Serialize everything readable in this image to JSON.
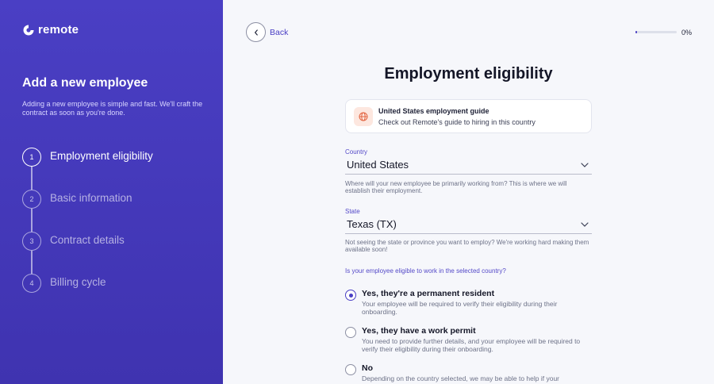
{
  "brand": {
    "name": "remote"
  },
  "sidebar": {
    "title": "Add a new employee",
    "description": "Adding a new employee is simple and fast. We'll craft the contract as soon as you're done.",
    "steps": [
      {
        "number": "1",
        "label": "Employment eligibility",
        "active": true
      },
      {
        "number": "2",
        "label": "Basic information",
        "active": false
      },
      {
        "number": "3",
        "label": "Contract details",
        "active": false
      },
      {
        "number": "4",
        "label": "Billing cycle",
        "active": false
      }
    ]
  },
  "header": {
    "back_label": "Back",
    "progress_text": "0%",
    "progress_fraction": 0.04
  },
  "main": {
    "title": "Employment eligibility",
    "guide": {
      "title": "United States employment guide",
      "subtitle": "Check out Remote's guide to hiring in this country"
    },
    "country": {
      "label": "Country",
      "value": "United States",
      "help": "Where will your new employee be primarily working from? This is where we will establish their employment."
    },
    "state": {
      "label": "State",
      "value": "Texas (TX)",
      "help": "Not seeing the state or province you want to employ? We're working hard making them available soon!"
    },
    "eligibility": {
      "question": "Is your employee eligible to work in the selected country?",
      "options": [
        {
          "title": "Yes, they're a permanent resident",
          "desc": "Your employee will be required to verify their eligibility during their onboarding.",
          "checked": true
        },
        {
          "title": "Yes, they have a work permit",
          "desc": "You need to provide further details, and your employee will be required to verify their eligibility during their onboarding.",
          "checked": false
        },
        {
          "title": "No",
          "desc": "Depending on the country selected, we may be able to help if your",
          "checked": false
        }
      ]
    }
  },
  "colors": {
    "accent": "#4a3fc4",
    "sidebar_bg": "#4438bd",
    "guide_icon_bg": "#fde7df",
    "guide_icon": "#e2633f"
  },
  "icons": {
    "logo": "remote-logo-icon",
    "back": "chevron-left-icon",
    "guide": "globe-icon",
    "dropdown": "chevron-down-icon"
  }
}
